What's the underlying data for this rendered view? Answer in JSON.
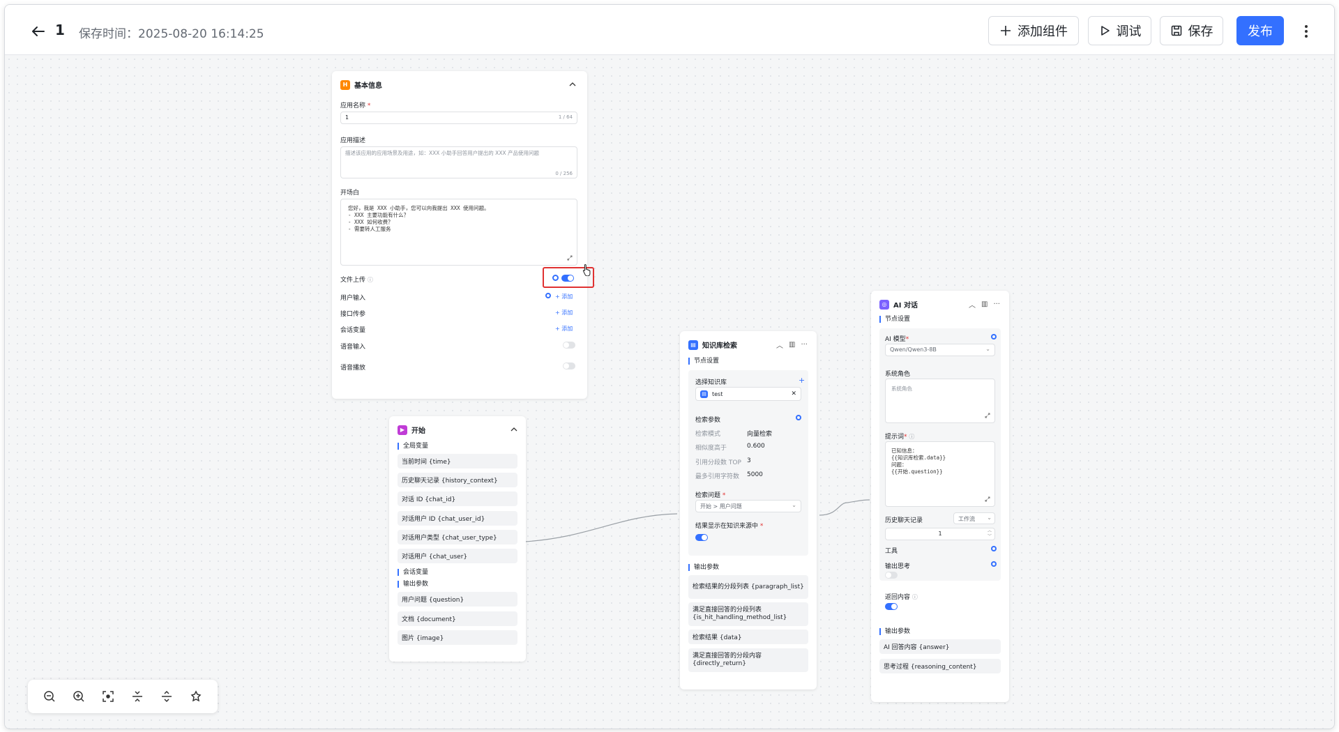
{
  "header": {
    "app_name": "1",
    "save_time": "保存时间：2025-08-20 16:14:25",
    "add_component": "添加组件",
    "debug": "调试",
    "save": "保存",
    "publish": "发布"
  },
  "colors": {
    "accent": "#3370ff",
    "highlight": "#e03131",
    "start_icon": "#c03cd6",
    "basic_icon": "#ff8800"
  },
  "basic_node": {
    "title": "基本信息",
    "app_name_label": "应用名称",
    "app_name_value": "1",
    "app_name_count": "1 / 64",
    "desc_label": "应用描述",
    "desc_placeholder": "描述该应用的应用场景及用途，如：XXX 小助手回答用户提出的 XXX 产品使用问题",
    "desc_count": "0 / 256",
    "prologue_label": "开场白",
    "prologue_text": "您好，我是 XXX 小助手，您可以向我提出 XXX 使用问题。\n- XXX 主要功能有什么？\n- XXX 如何收费？\n- 需要转人工服务",
    "file_upload_label": "文件上传",
    "user_input_label": "用户输入",
    "api_param_label": "接口传参",
    "session_var_label": "会话变量",
    "voice_input_label": "语音输入",
    "voice_play_label": "语音播放",
    "add_label": "添加",
    "file_upload_on": true
  },
  "start_node": {
    "title": "开始",
    "global_vars_label": "全局变量",
    "global_vars": [
      "当前时间 {time}",
      "历史聊天记录 {history_context}",
      "对话 ID {chat_id}",
      "对话用户 ID {chat_user_id}",
      "对话用户类型 {chat_user_type}",
      "对话用户 {chat_user}"
    ],
    "session_vars_label": "会话变量",
    "output_label": "输出参数",
    "outputs": [
      "用户问题 {question}",
      "文档 {document}",
      "图片 {image}"
    ]
  },
  "kb_node": {
    "title": "知识库检索",
    "settings_label": "节点设置",
    "select_kb_label": "选择知识库",
    "kb_item": "test",
    "search_params_label": "检索参数",
    "params": [
      {
        "k": "检索模式",
        "v": "向量检索"
      },
      {
        "k": "相似度高于",
        "v": "0.600"
      },
      {
        "k": "引用分段数 TOP",
        "v": "3"
      },
      {
        "k": "最多引用字符数",
        "v": "5000"
      }
    ],
    "question_label": "检索问题",
    "question_value": "开始 > 用户问题",
    "show_in_source_label": "结果显示在知识来源中",
    "output_label": "输出参数",
    "outputs": [
      "检索结果的分段列表 {paragraph_list}",
      "满足直接回答的分段列表 {is_hit_handling_method_list}",
      "检索结果 {data}",
      "满足直接回答的分段内容 {directly_return}"
    ]
  },
  "ai_node": {
    "title": "AI 对话",
    "settings_label": "节点设置",
    "model_label": "AI 模型",
    "model_value": "Qwen/Qwen3-8B",
    "system_role_label": "系统角色",
    "system_role_placeholder": "系统角色",
    "prompt_label": "提示词",
    "prompt_text": "已知信息：\n{{知识库检索.data}}\n问题：\n{{开始.question}}",
    "history_label": "历史聊天记录",
    "history_mode": "工作流",
    "history_count": "1",
    "tools_label": "工具",
    "output_thinking_label": "输出思考",
    "return_content_label": "返回内容",
    "output_label": "输出参数",
    "outputs": [
      "AI 回答内容 {answer}",
      "思考过程 {reasoning_content}"
    ]
  }
}
